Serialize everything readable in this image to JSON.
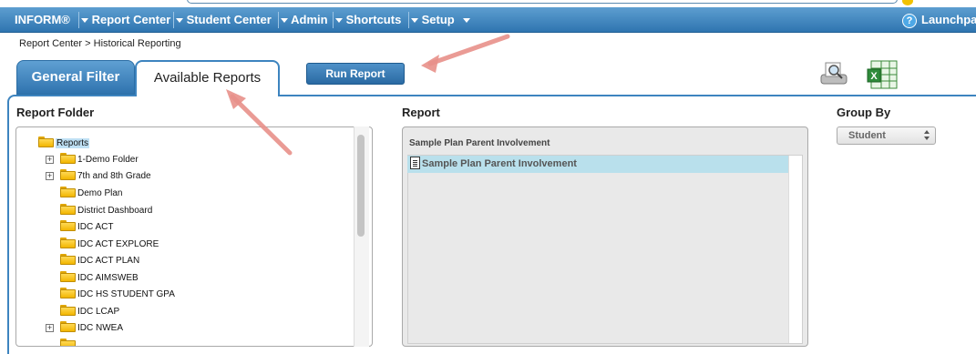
{
  "nav": {
    "items": [
      {
        "label": "INFORM®"
      },
      {
        "label": "Report Center"
      },
      {
        "label": "Student Center"
      },
      {
        "label": "Admin"
      },
      {
        "label": "Shortcuts"
      },
      {
        "label": "Setup"
      }
    ],
    "launchpad": "Launchpad"
  },
  "breadcrumb": "Report Center > Historical Reporting",
  "tabs": {
    "general": "General Filter",
    "available": "Available Reports"
  },
  "run_button": "Run Report",
  "icons": {
    "preview": "print-preview-icon",
    "excel": "excel-export-icon"
  },
  "columns": {
    "folder": "Report Folder",
    "report": "Report",
    "group": "Group By"
  },
  "tree": {
    "root": "Reports",
    "items": [
      {
        "label": "1-Demo Folder",
        "expandable": true
      },
      {
        "label": "7th and 8th Grade",
        "expandable": true
      },
      {
        "label": "Demo Plan",
        "expandable": false
      },
      {
        "label": "District Dashboard",
        "expandable": false
      },
      {
        "label": "IDC ACT",
        "expandable": false
      },
      {
        "label": "IDC ACT EXPLORE",
        "expandable": false
      },
      {
        "label": "IDC ACT PLAN",
        "expandable": false
      },
      {
        "label": "IDC AIMSWEB",
        "expandable": false
      },
      {
        "label": "IDC HS STUDENT GPA",
        "expandable": false
      },
      {
        "label": "IDC LCAP",
        "expandable": false
      },
      {
        "label": "IDC NWEA",
        "expandable": true
      }
    ]
  },
  "report": {
    "header": "Sample Plan Parent Involvement",
    "selected": "Sample Plan Parent Involvement"
  },
  "group_by": {
    "value": "Student"
  },
  "colors": {
    "nav_top": "#5d9ed0",
    "nav_bottom": "#2f75b0",
    "accent_border": "#3d84bf",
    "selection": "#b9e0ec",
    "annotation_arrow": "#e8908a"
  }
}
